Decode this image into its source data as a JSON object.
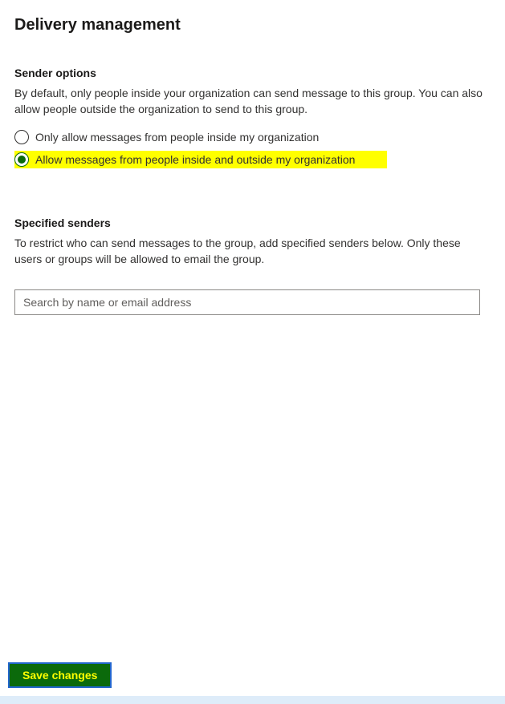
{
  "page": {
    "title": "Delivery management"
  },
  "senderOptions": {
    "heading": "Sender options",
    "description": "By default, only people inside your organization can send message to this group. You can also allow people outside the organization to send to this group.",
    "radios": [
      {
        "label": "Only allow messages from people inside my organization",
        "selected": false
      },
      {
        "label": "Allow messages from people inside and outside my organization",
        "selected": true
      }
    ]
  },
  "specifiedSenders": {
    "heading": "Specified senders",
    "description": "To restrict who can send messages to the group, add specified senders below. Only these users or groups will be allowed to email the group.",
    "searchPlaceholder": "Search by name or email address",
    "searchValue": ""
  },
  "actions": {
    "saveLabel": "Save changes"
  }
}
